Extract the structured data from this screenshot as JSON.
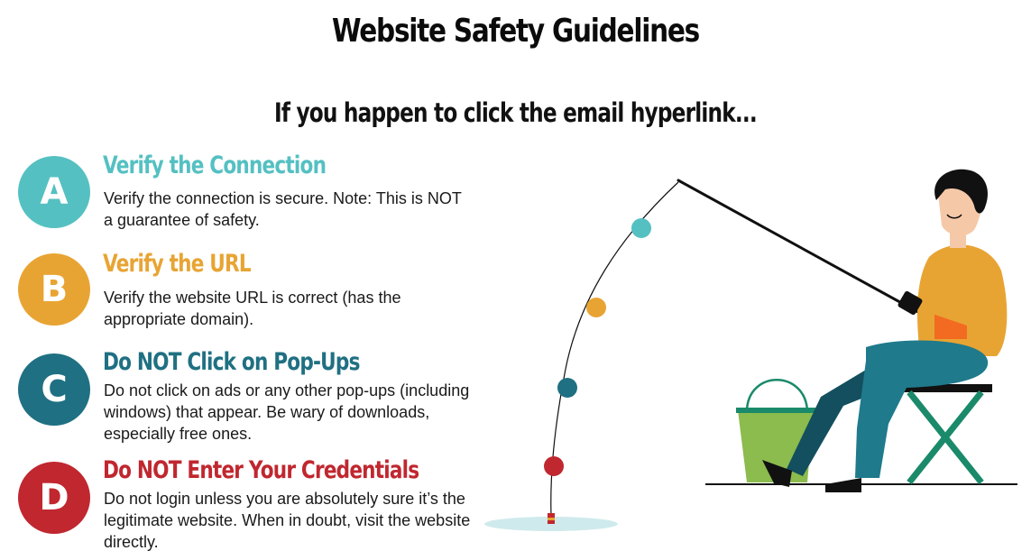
{
  "title": "Website Safety Guidelines",
  "subtitle": "If you happen to click the email hyperlink...",
  "items": [
    {
      "letter": "A",
      "heading": "Verify the Connection",
      "text": "Verify the connection is secure. Note: This is NOT a guarantee of safety.",
      "color": "#55c0c2"
    },
    {
      "letter": "B",
      "heading": "Verify the URL",
      "text": "Verify the website URL is correct (has the appropriate domain).",
      "color": "#e8a433"
    },
    {
      "letter": "C",
      "heading": "Do NOT Click on Pop-Ups",
      "text": "Do not click on ads or any other pop-ups (including windows) that appear. Be wary of downloads, especially free ones.",
      "color": "#1f7082"
    },
    {
      "letter": "D",
      "heading": "Do NOT Enter Your Credentials",
      "text": "Do not login unless you are absolutely sure it’s the legitimate website. When in doubt, visit the website directly.",
      "color": "#c0272f"
    }
  ],
  "illustration": {
    "name": "person-fishing-illustration"
  }
}
